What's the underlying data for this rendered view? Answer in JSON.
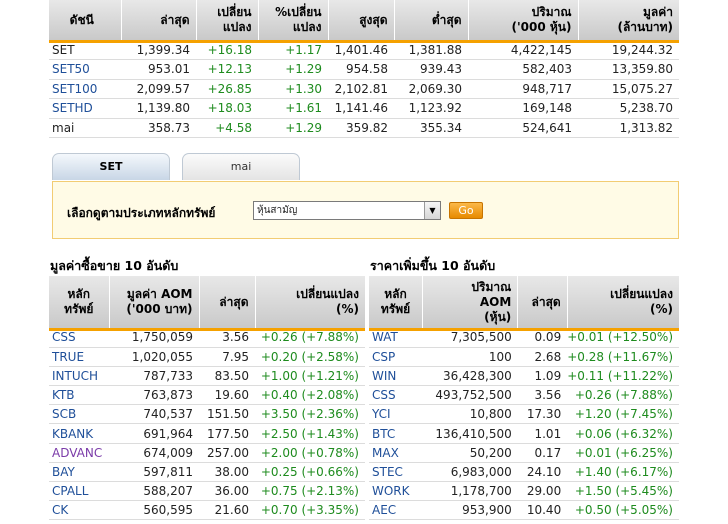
{
  "index_table": {
    "headers": [
      "ดัชนี",
      "ล่าสุด",
      "เปลี่ยน\nแปลง",
      "%เปลี่ยน\nแปลง",
      "สูงสุด",
      "ต่ำสุด",
      "ปริมาณ\n('000 หุ้น)",
      "มูลค่า\n(ล้านบาท)"
    ],
    "rows": [
      {
        "name": "SET",
        "last": "1,399.34",
        "change": "+16.18",
        "pct": "+1.17",
        "high": "1,401.46",
        "low": "1,381.88",
        "volume": "4,422,145",
        "value": "19,244.32",
        "link": false
      },
      {
        "name": "SET50",
        "last": "953.01",
        "change": "+12.13",
        "pct": "+1.29",
        "high": "954.58",
        "low": "939.43",
        "volume": "582,403",
        "value": "13,359.80",
        "link": true
      },
      {
        "name": "SET100",
        "last": "2,099.57",
        "change": "+26.85",
        "pct": "+1.30",
        "high": "2,102.81",
        "low": "2,069.30",
        "volume": "948,717",
        "value": "15,075.27",
        "link": true
      },
      {
        "name": "SETHD",
        "last": "1,139.80",
        "change": "+18.03",
        "pct": "+1.61",
        "high": "1,141.46",
        "low": "1,123.92",
        "volume": "169,148",
        "value": "5,238.70",
        "link": true
      },
      {
        "name": "mai",
        "last": "358.73",
        "change": "+4.58",
        "pct": "+1.29",
        "high": "359.82",
        "low": "355.34",
        "volume": "524,641",
        "value": "1,313.82",
        "link": false
      }
    ]
  },
  "tabs": [
    {
      "label": "SET",
      "active": true
    },
    {
      "label": "mai",
      "active": false
    }
  ],
  "filter": {
    "label": "เลือกดูตามประเภทหลักทรัพย์",
    "selected": "หุ้นสามัญ",
    "go_label": "Go"
  },
  "top_value": {
    "title": "มูลค่าซื้อขาย 10 อันดับ",
    "headers": [
      "หลัก\nทรัพย์",
      "มูลค่า AOM\n('000 บาท)",
      "ล่าสุด",
      "เปลี่ยนแปลง\n(%)"
    ],
    "rows": [
      {
        "symbol": "CSS",
        "aom": "1,750,059",
        "last": "3.56",
        "change": "+0.26 (+7.88%)"
      },
      {
        "symbol": "TRUE",
        "aom": "1,020,055",
        "last": "7.95",
        "change": "+0.20 (+2.58%)"
      },
      {
        "symbol": "INTUCH",
        "aom": "787,733",
        "last": "83.50",
        "change": "+1.00 (+1.21%)"
      },
      {
        "symbol": "KTB",
        "aom": "763,873",
        "last": "19.60",
        "change": "+0.40 (+2.08%)"
      },
      {
        "symbol": "SCB",
        "aom": "740,537",
        "last": "151.50",
        "change": "+3.50 (+2.36%)"
      },
      {
        "symbol": "KBANK",
        "aom": "691,964",
        "last": "177.50",
        "change": "+2.50 (+1.43%)"
      },
      {
        "symbol": "ADVANC",
        "aom": "674,009",
        "last": "257.00",
        "change": "+2.00 (+0.78%)"
      },
      {
        "symbol": "BAY",
        "aom": "597,811",
        "last": "38.00",
        "change": "+0.25 (+0.66%)"
      },
      {
        "symbol": "CPALL",
        "aom": "588,207",
        "last": "36.00",
        "change": "+0.75 (+2.13%)"
      },
      {
        "symbol": "CK",
        "aom": "560,595",
        "last": "21.60",
        "change": "+0.70 (+3.35%)"
      }
    ]
  },
  "top_gainers": {
    "title": "ราคาเพิ่มขึ้น 10 อันดับ",
    "headers": [
      "หลัก\nทรัพย์",
      "ปริมาณ\nAOM\n(หุ้น)",
      "ล่าสุด",
      "เปลี่ยนแปลง\n(%)"
    ],
    "rows": [
      {
        "symbol": "WAT",
        "aom": "7,305,500",
        "last": "0.09",
        "change": "+0.01 (+12.50%)"
      },
      {
        "symbol": "CSP",
        "aom": "100",
        "last": "2.68",
        "change": "+0.28 (+11.67%)"
      },
      {
        "symbol": "WIN",
        "aom": "36,428,300",
        "last": "1.09",
        "change": "+0.11 (+11.22%)"
      },
      {
        "symbol": "CSS",
        "aom": "493,752,500",
        "last": "3.56",
        "change": "+0.26 (+7.88%)"
      },
      {
        "symbol": "YCI",
        "aom": "10,800",
        "last": "17.30",
        "change": "+1.20 (+7.45%)"
      },
      {
        "symbol": "BTC",
        "aom": "136,410,500",
        "last": "1.01",
        "change": "+0.06 (+6.32%)"
      },
      {
        "symbol": "MAX",
        "aom": "50,200",
        "last": "0.17",
        "change": "+0.01 (+6.25%)"
      },
      {
        "symbol": "STEC",
        "aom": "6,983,000",
        "last": "24.10",
        "change": "+1.40 (+6.17%)"
      },
      {
        "symbol": "WORK",
        "aom": "1,178,700",
        "last": "29.00",
        "change": "+1.50 (+5.45%)"
      },
      {
        "symbol": "AEC",
        "aom": "953,900",
        "last": "10.40",
        "change": "+0.50 (+5.05%)"
      }
    ]
  },
  "colors": {
    "accent_bar": "#f5a100",
    "link": "#1f4f99",
    "positive": "#1e8b1e",
    "advanc": "#7a3aa8"
  }
}
